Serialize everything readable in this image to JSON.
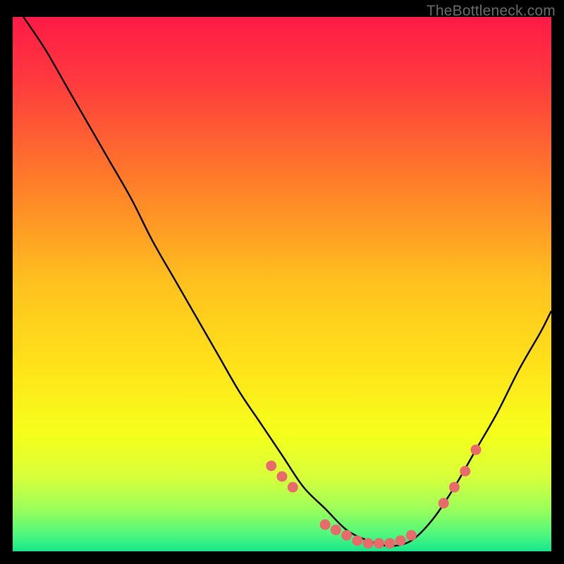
{
  "watermark": "TheBottleneck.com",
  "chart_data": {
    "type": "line",
    "title": "",
    "xlabel": "",
    "ylabel": "",
    "xlim": [
      0,
      100
    ],
    "ylim": [
      0,
      100
    ],
    "series": [
      {
        "name": "bottleneck-curve",
        "x": [
          2,
          6,
          10,
          14,
          18,
          22,
          26,
          30,
          34,
          38,
          42,
          46,
          50,
          54,
          58,
          62,
          66,
          70,
          74,
          78,
          82,
          86,
          90,
          94,
          98,
          100
        ],
        "y": [
          100,
          94,
          87,
          80,
          73,
          66,
          58,
          51,
          44,
          37,
          30,
          24,
          18,
          12,
          8,
          4,
          2,
          1,
          2,
          6,
          12,
          19,
          26,
          34,
          41,
          45
        ]
      }
    ],
    "markers": {
      "name": "highlight-points",
      "x": [
        48,
        50,
        52,
        58,
        60,
        62,
        64,
        66,
        68,
        70,
        72,
        74,
        80,
        82,
        84,
        86
      ],
      "y": [
        16,
        14,
        12,
        5,
        4,
        3,
        2,
        1.5,
        1.5,
        1.5,
        2,
        3,
        9,
        12,
        15,
        19
      ]
    },
    "gradient_stops": [
      {
        "offset": 0.0,
        "color": "#ff1a46"
      },
      {
        "offset": 0.12,
        "color": "#ff3a3e"
      },
      {
        "offset": 0.3,
        "color": "#ff7a2a"
      },
      {
        "offset": 0.5,
        "color": "#ffc21e"
      },
      {
        "offset": 0.66,
        "color": "#ffe41a"
      },
      {
        "offset": 0.78,
        "color": "#f5ff1a"
      },
      {
        "offset": 0.86,
        "color": "#d8ff3a"
      },
      {
        "offset": 0.92,
        "color": "#9dff5a"
      },
      {
        "offset": 0.97,
        "color": "#4cf77e"
      },
      {
        "offset": 1.0,
        "color": "#17e68b"
      }
    ],
    "marker_color": "#e86a6a",
    "curve_color": "#000000"
  }
}
